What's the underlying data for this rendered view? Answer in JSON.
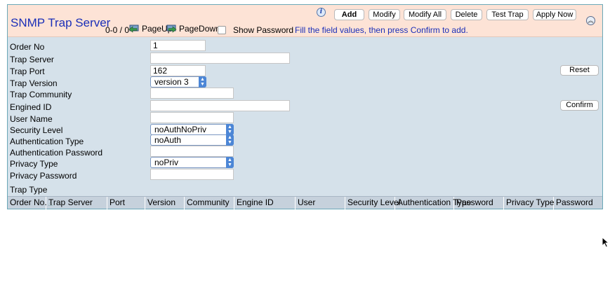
{
  "header": {
    "title": "SNMP Trap Server",
    "pager_range": "0-0 / 0",
    "page_up": "PageUp",
    "page_down": "PageDown",
    "show_password": "Show Password",
    "hint": "Fill the field values, then press Confirm to add.",
    "info_glyph": "i",
    "buttons": {
      "add": "Add",
      "modify": "Modify",
      "modify_all": "Modify All",
      "delete": "Delete",
      "test_trap": "Test Trap",
      "apply_now": "Apply Now"
    }
  },
  "form": {
    "order_no": {
      "label": "Order No",
      "value": "1"
    },
    "trap_server": {
      "label": "Trap Server",
      "value": ""
    },
    "trap_port": {
      "label": "Trap Port",
      "value": "162"
    },
    "trap_version": {
      "label": "Trap Version",
      "value": "version 3"
    },
    "trap_community": {
      "label": "Trap Community",
      "value": ""
    },
    "engined_id": {
      "label": "Engined ID",
      "value": ""
    },
    "user_name": {
      "label": "User Name",
      "value": ""
    },
    "security_level": {
      "label": "Security Level",
      "value": "noAuthNoPriv"
    },
    "auth_type": {
      "label": "Authentication Type",
      "value": "noAuth"
    },
    "auth_password": {
      "label": "Authentication Password",
      "value": ""
    },
    "privacy_type": {
      "label": "Privacy Type",
      "value": "noPriv"
    },
    "privacy_password": {
      "label": "Privacy Password",
      "value": ""
    },
    "trap_type": {
      "label": "Trap Type"
    },
    "reset": "Reset",
    "confirm": "Confirm"
  },
  "table": {
    "columns": [
      "Order No.",
      "Trap Server",
      "Port",
      "Version",
      "Community",
      "Engine ID",
      "User",
      "Security Level",
      "Authentication Type",
      "Password",
      "Privacy Type",
      "Password"
    ],
    "sort_indicator": "△"
  },
  "icons": {
    "info": "info-icon",
    "page_up": "page-up-icon",
    "page_down": "page-down-icon",
    "collapse": "collapse-up-icon",
    "select_arrow": "select-updown-icon",
    "cursor": "mouse-pointer-icon"
  },
  "colors": {
    "header_bg": "#fde3d6",
    "panel_bg": "#d5e1ea",
    "title": "#1a2fb8",
    "accent": "#4c86d6",
    "table_header": "#c6d1dc"
  }
}
